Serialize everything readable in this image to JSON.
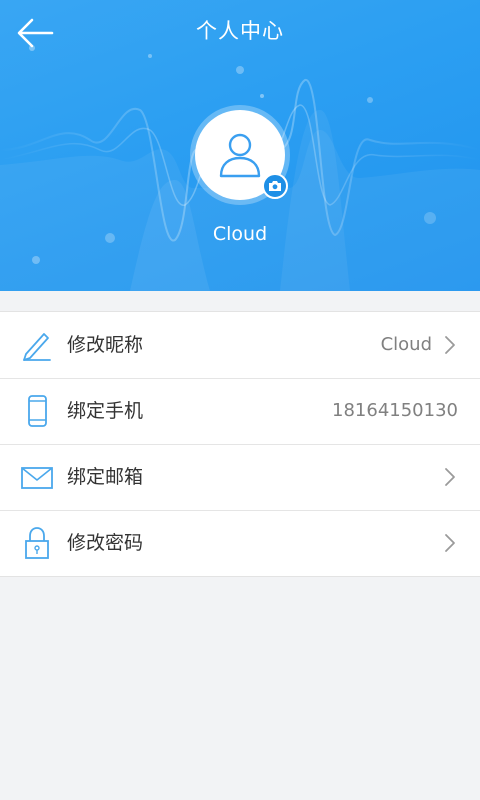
{
  "header": {
    "title": "个人中心",
    "username": "Cloud"
  },
  "icons": {
    "back": "back-arrow-icon",
    "avatar": "user-silhouette-icon",
    "camera": "camera-icon"
  },
  "menu": {
    "items": [
      {
        "label": "修改昵称",
        "value": "Cloud",
        "icon": "pencil-icon",
        "chevron": true
      },
      {
        "label": "绑定手机",
        "value": "18164150130",
        "icon": "phone-icon",
        "chevron": false
      },
      {
        "label": "绑定邮箱",
        "value": "",
        "icon": "envelope-icon",
        "chevron": true
      },
      {
        "label": "修改密码",
        "value": "",
        "icon": "lock-icon",
        "chevron": true
      }
    ]
  },
  "colors": {
    "header_blue": "#2c9ff2",
    "icon_blue": "#4aa8ec",
    "background": "#f2f3f5"
  }
}
